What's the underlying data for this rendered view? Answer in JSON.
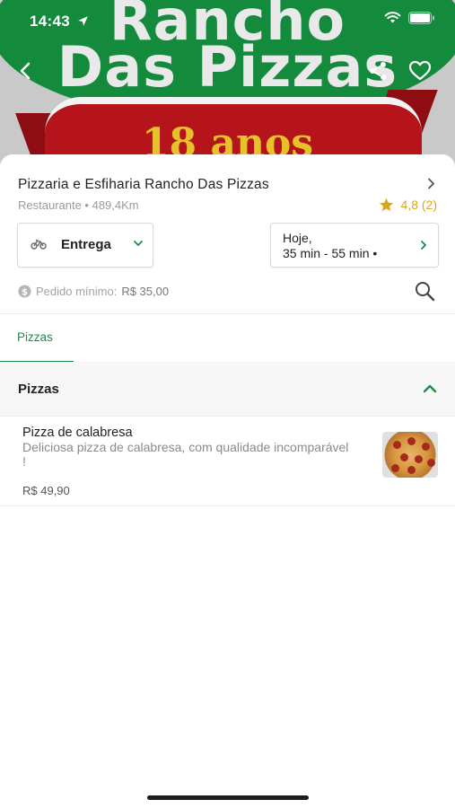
{
  "status_bar": {
    "time": "14:43"
  },
  "banner": {
    "title_line1": "Rancho",
    "title_line2": "Das Pizzas",
    "ribbon_text": "18 anos"
  },
  "store": {
    "name": "Pizzaria e Esfiharia Rancho Das Pizzas",
    "meta": "Restaurante • 489,4Km",
    "rating": "4,8 (2)"
  },
  "delivery": {
    "label": "Entrega"
  },
  "schedule": {
    "line1": "Hoje,",
    "line2": "35 min - 55 min •"
  },
  "min_order": {
    "label": "Pedido mínimo:",
    "value": "R$ 35,00"
  },
  "tabs": [
    {
      "label": "Pizzas"
    }
  ],
  "sections": [
    {
      "title": "Pizzas",
      "products": [
        {
          "name": "Pizza de calabresa",
          "description": "Deliciosa pizza de calabresa, com qualidade incomparável !",
          "price": "R$ 49,90"
        }
      ]
    }
  ],
  "colors": {
    "accent": "#1a8d4d",
    "rating": "#d9a521",
    "banner_green": "#138a3c",
    "ribbon_red": "#b4141a"
  },
  "icons": [
    "location-arrow-icon",
    "wifi-icon",
    "battery-icon",
    "back-icon",
    "share-icon",
    "heart-icon",
    "chevron-right-icon",
    "star-icon",
    "bike-icon",
    "chevron-down-icon",
    "dollar-icon",
    "search-icon",
    "chevron-up-icon"
  ]
}
